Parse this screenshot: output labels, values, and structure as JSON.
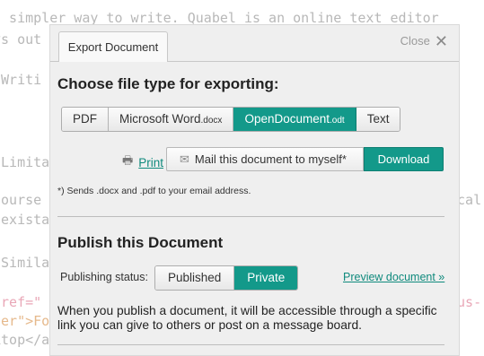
{
  "background_editor": {
    "lines": [
      {
        "text": "a simpler way to write. Quabel is an online text editor"
      },
      {
        "text": "ys out"
      },
      {
        "text": "-Writi"
      },
      {
        "text": "-Limita"
      },
      {
        "text": "course",
        "right": "ical"
      },
      {
        "text": "-exista"
      },
      {
        "text": "-Simila"
      },
      {
        "text": "href=\"",
        "right": "cus-"
      },
      {
        "text": "ter\">Fo"
      },
      {
        "text": "ktop</a"
      }
    ]
  },
  "dialog": {
    "tab_label": "Export Document",
    "close_label": "Close",
    "close_icon": "close-icon",
    "export": {
      "heading": "Choose file type for exporting:",
      "file_types": [
        {
          "label": "PDF",
          "ext": "",
          "active": false
        },
        {
          "label": "Microsoft Word",
          "ext": ".docx",
          "active": false
        },
        {
          "label": "OpenDocument",
          "ext": ".odt",
          "active": true
        },
        {
          "label": "Text",
          "ext": "",
          "active": false
        }
      ],
      "print_label": "Print",
      "mail_label": "Mail this document to myself*",
      "download_label": "Download",
      "note": "*) Sends .docx and .pdf to your email address."
    },
    "publish": {
      "heading": "Publish this Document",
      "status_label": "Publishing status:",
      "options": [
        {
          "label": "Published",
          "active": false
        },
        {
          "label": "Private",
          "active": true
        }
      ],
      "preview_link": "Preview document »",
      "description": "When you publish a document, it will be accessible through a specific link you can give to others or post on a message board."
    }
  },
  "colors": {
    "accent": "#13998a",
    "link": "#108a7d",
    "dialog_bg": "#efefef"
  }
}
